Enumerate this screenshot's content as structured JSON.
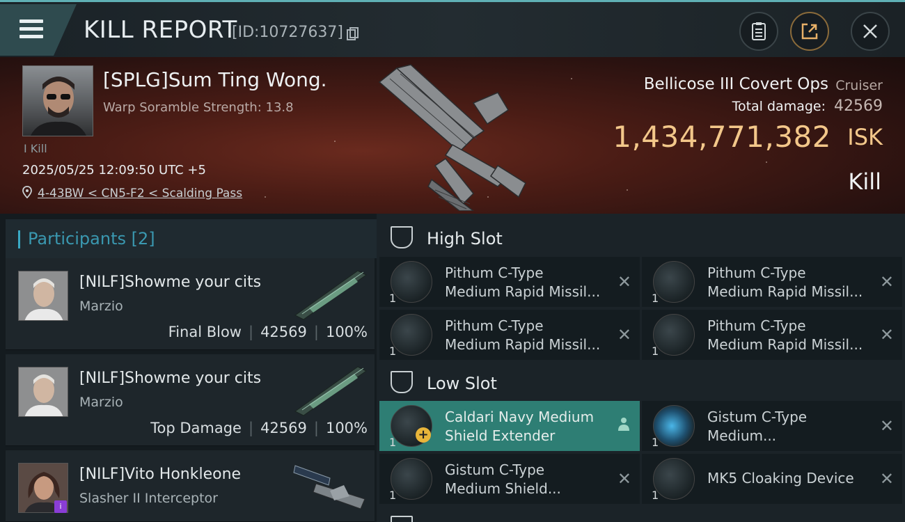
{
  "header": {
    "title": "KILL REPORT",
    "kill_id": "[ID:10727637]"
  },
  "victim": {
    "name": "[SPLG]Sum Ting Wong.",
    "warp_scramble": "Warp Soramble Strength: 13.8",
    "kill_tag": "I Kill",
    "timestamp": "2025/05/25 12:09:50 UTC +5",
    "location": "4-43BW < CN5-F2 < Scalding Pass",
    "ship_name": "Bellicose III Covert Ops",
    "ship_class": "Cruiser",
    "total_damage_label": "Total damage:",
    "total_damage": "42569",
    "isk_value": "1,434,771,382",
    "isk_unit": "ISK",
    "result": "Kill"
  },
  "participants": {
    "title": "Participants",
    "count": "[2]",
    "items": [
      {
        "name": "[NILF]Showme your cits",
        "ship": "Marzio",
        "role": "Final Blow",
        "damage": "42569",
        "percent": "100%"
      },
      {
        "name": "[NILF]Showme your cits",
        "ship": "Marzio",
        "role": "Top Damage",
        "damage": "42569",
        "percent": "100%"
      },
      {
        "name": "[NILF]Vito Honkleone",
        "ship": "Slasher II Interceptor",
        "role": "",
        "damage": "",
        "percent": ""
      }
    ]
  },
  "slots": {
    "high": {
      "title": "High Slot",
      "modules": [
        {
          "line1": "Pithum C-Type",
          "line2": "Medium Rapid Missil...",
          "qty": "1"
        },
        {
          "line1": "Pithum C-Type",
          "line2": "Medium Rapid Missil...",
          "qty": "1"
        },
        {
          "line1": "Pithum C-Type",
          "line2": "Medium Rapid Missil...",
          "qty": "1"
        },
        {
          "line1": "Pithum C-Type",
          "line2": "Medium Rapid Missil...",
          "qty": "1"
        }
      ]
    },
    "low": {
      "title": "Low Slot",
      "modules": [
        {
          "line1": "Caldari Navy Medium",
          "line2": "Shield Extender",
          "qty": "1"
        },
        {
          "line1": "Gistum C-Type",
          "line2": "Medium...",
          "qty": "1"
        },
        {
          "line1": "Gistum C-Type",
          "line2": "Medium Shield...",
          "qty": "1"
        },
        {
          "line1": "MK5 Cloaking Device",
          "line2": "",
          "qty": "1"
        }
      ]
    }
  },
  "colors": {
    "accent_teal": "#3aa9c4",
    "isk_gold": "#f3c78a",
    "highlight_module": "#2e7e74"
  }
}
